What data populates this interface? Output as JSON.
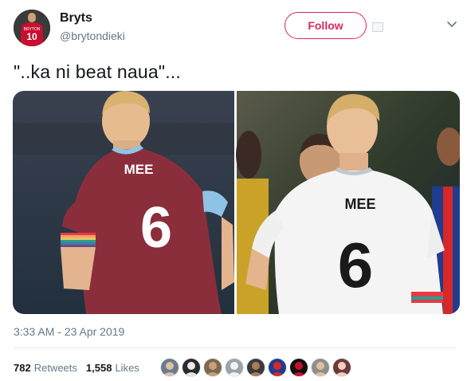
{
  "author": {
    "name": "Bryts",
    "handle": "@brytondieki",
    "avatar_jersey_name": "BRYTON",
    "avatar_jersey_number": "10"
  },
  "follow_label": "Follow",
  "tweet_text": "\"..ka ni beat naua\"...",
  "media": {
    "left_shirt_name": "MEE",
    "left_shirt_number": "6",
    "right_shirt_name": "MEE",
    "right_shirt_number": "6"
  },
  "timestamp": "3:33 AM - 23 Apr 2019",
  "stats": {
    "retweets_count": "782",
    "retweets_label": "Retweets",
    "likes_count": "1,558",
    "likes_label": "Likes"
  },
  "likers_count": 9,
  "colors": {
    "follow": "#e0245e",
    "muted": "#657786",
    "claret": "#8b2e3c",
    "sky_blue": "#8fc3e6"
  },
  "icons": [
    "flag-icon",
    "chevron-down-icon"
  ]
}
